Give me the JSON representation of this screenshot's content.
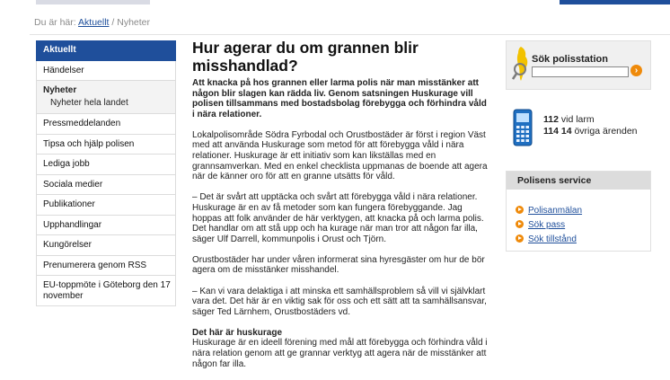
{
  "breadcrumb": {
    "prefix": "Du är här: ",
    "link": "Aktuellt",
    "separator": " / ",
    "current": "Nyheter"
  },
  "nav": {
    "active": "Aktuellt",
    "items_top": [
      "Händelser"
    ],
    "group": {
      "head": "Nyheter",
      "sub": "Nyheter hela landet"
    },
    "items": [
      "Pressmeddelanden",
      "Tipsa och hjälp polisen",
      "Lediga jobb",
      "Sociala medier",
      "Publikationer",
      "Upphandlingar",
      "Kungörelser",
      "Prenumerera genom RSS"
    ],
    "last": "EU-toppmöte i Göteborg den 17 november"
  },
  "article": {
    "title": "Hur agerar du om grannen blir misshandlad?",
    "lead": "Att knacka på hos grannen eller larma polis när man misstänker att någon blir slagen kan rädda liv. Genom satsningen Huskurage vill polisen tillsammans med bostadsbolag förebygga och förhindra våld i nära relationer.",
    "p1": "Lokalpolisområde Södra Fyrbodal och Orustbostäder är först i region Väst med att använda Huskurage som metod för att förebygga våld i nära relationer. Huskurage är ett initiativ som kan likställas med en grannsamverkan. Med en enkel checklista uppmanas de boende att agera när de känner oro för att en granne utsätts för våld.",
    "p2": "– Det är svårt att upptäcka och svårt att förebygga våld i nära relationer. Huskurage är en av få metoder som kan fungera förebyggande. Jag hoppas att folk använder de här verktygen, att knacka på och larma polis. Det handlar om att stå upp och ha kurage när man tror att någon far illa, säger Ulf Darrell, kommunpolis i Orust och Tjörn.",
    "p3": "Orustbostäder har under våren informerat sina hyresgäster om hur de bör agera om de misstänker misshandel.",
    "p4": "– Kan vi vara delaktiga i att minska ett samhällsproblem så vill vi självklart vara det. Det här är en viktig sak för oss och ett sätt att ta samhällsansvar, säger Ted Lärnhem, Orustbostäders vd.",
    "h3": "Det här är huskurage",
    "p5": "Huskurage är en ideell förening med mål att förebygga och förhindra våld i nära relation genom att ge grannar verktyg att agera när de misstänker att någon far illa."
  },
  "station": {
    "label": "Sök polisstation",
    "value": "",
    "go_icon": "arrow-right-icon"
  },
  "phone": {
    "n1": "112",
    "t1": " vid larm",
    "n2": "114 14",
    "t2": " övriga ärenden"
  },
  "service": {
    "head": "Polisens service",
    "links": [
      "Polisanmälan",
      "Sök pass",
      "Sök tillstånd"
    ]
  },
  "colors": {
    "accent": "#1f4f9b",
    "orange": "#ef8a0a"
  }
}
